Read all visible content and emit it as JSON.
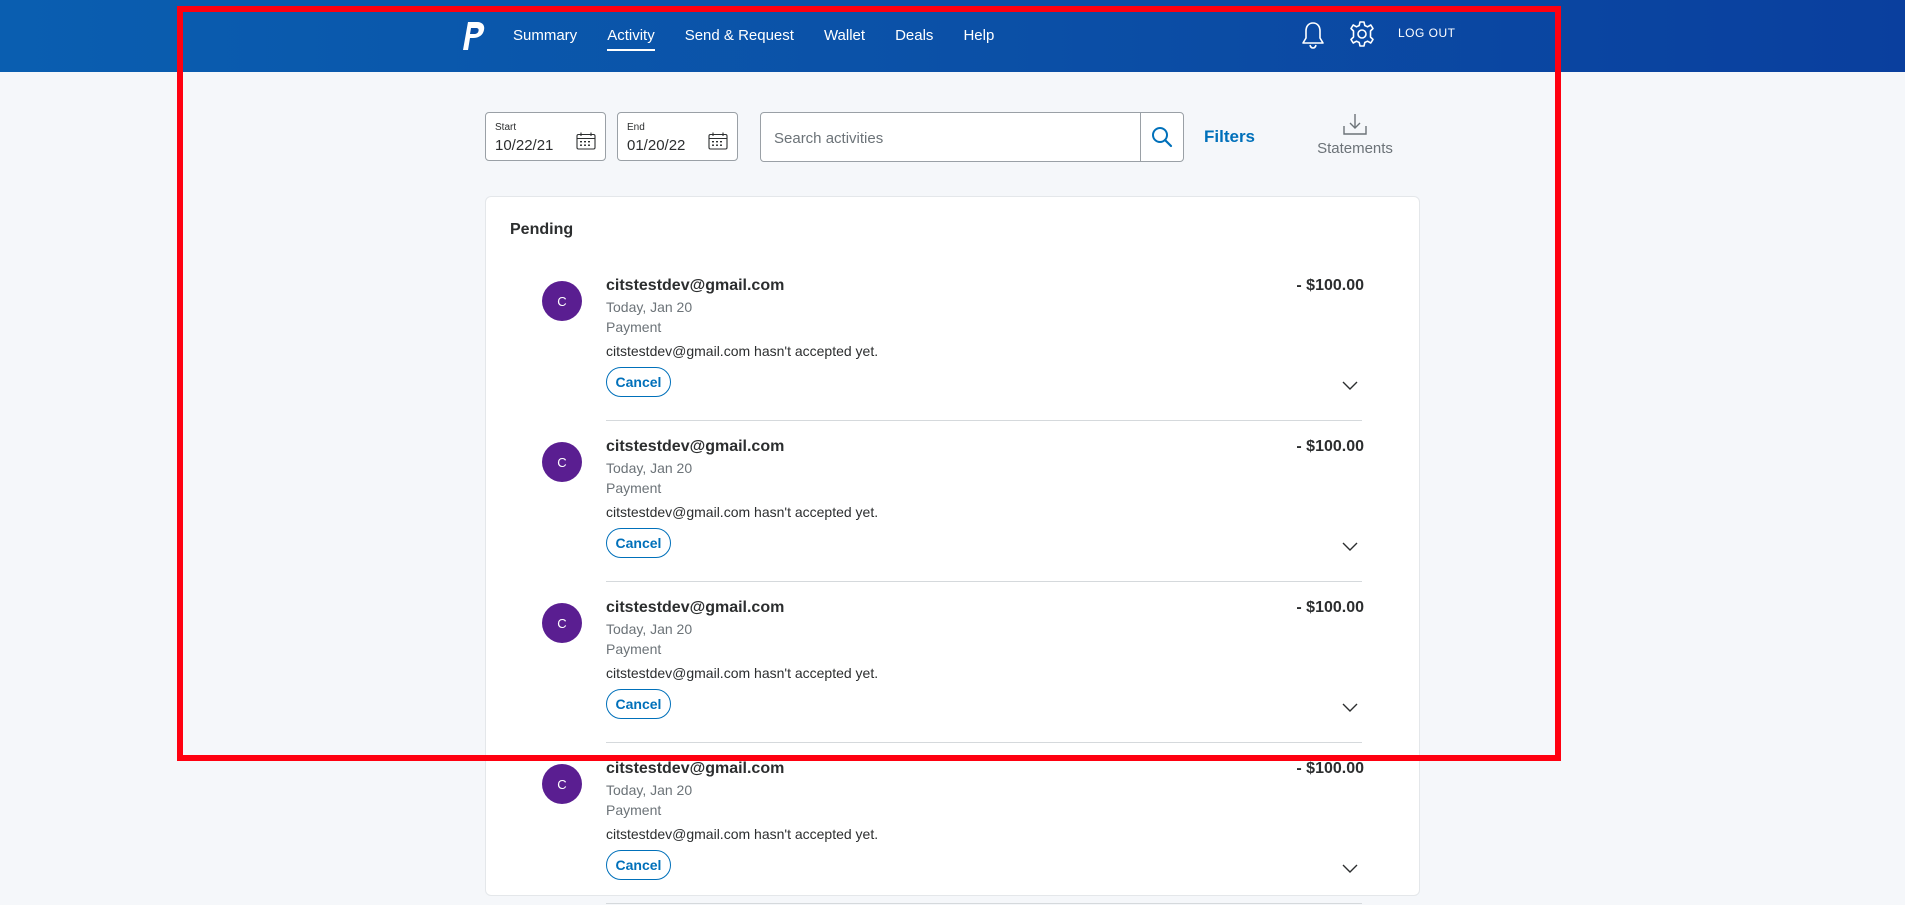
{
  "header": {
    "nav": [
      "Summary",
      "Activity",
      "Send & Request",
      "Wallet",
      "Deals",
      "Help"
    ],
    "active_nav": "Activity",
    "logout_label": "LOG OUT",
    "brand_color": "#0b4fa6"
  },
  "filters": {
    "start_label": "Start",
    "start_value": "10/22/21",
    "end_label": "End",
    "end_value": "01/20/22",
    "search_placeholder": "Search activities",
    "filters_label": "Filters",
    "statements_label": "Statements"
  },
  "pending": {
    "title": "Pending",
    "items": [
      {
        "initial": "C",
        "name": "citstestdev@gmail.com",
        "date": "Today, Jan 20",
        "type": "Payment",
        "note": "citstestdev@gmail.com hasn't accepted yet.",
        "amount": "- $100.00",
        "cancel_label": "Cancel"
      },
      {
        "initial": "C",
        "name": "citstestdev@gmail.com",
        "date": "Today, Jan 20",
        "type": "Payment",
        "note": "citstestdev@gmail.com hasn't accepted yet.",
        "amount": "- $100.00",
        "cancel_label": "Cancel"
      },
      {
        "initial": "C",
        "name": "citstestdev@gmail.com",
        "date": "Today, Jan 20",
        "type": "Payment",
        "note": "citstestdev@gmail.com hasn't accepted yet.",
        "amount": "- $100.00",
        "cancel_label": "Cancel"
      },
      {
        "initial": "C",
        "name": "citstestdev@gmail.com",
        "date": "Today, Jan 20",
        "type": "Payment",
        "note": "citstestdev@gmail.com hasn't accepted yet.",
        "amount": "- $100.00",
        "cancel_label": "Cancel"
      }
    ]
  },
  "colors": {
    "avatar": "#5a1e91",
    "link": "#0070ba",
    "highlight_frame": "#ff0010"
  },
  "icons": [
    "paypal-logo-icon",
    "bell-icon",
    "gear-icon",
    "calendar-icon",
    "search-icon",
    "download-icon",
    "chevron-down-icon"
  ]
}
